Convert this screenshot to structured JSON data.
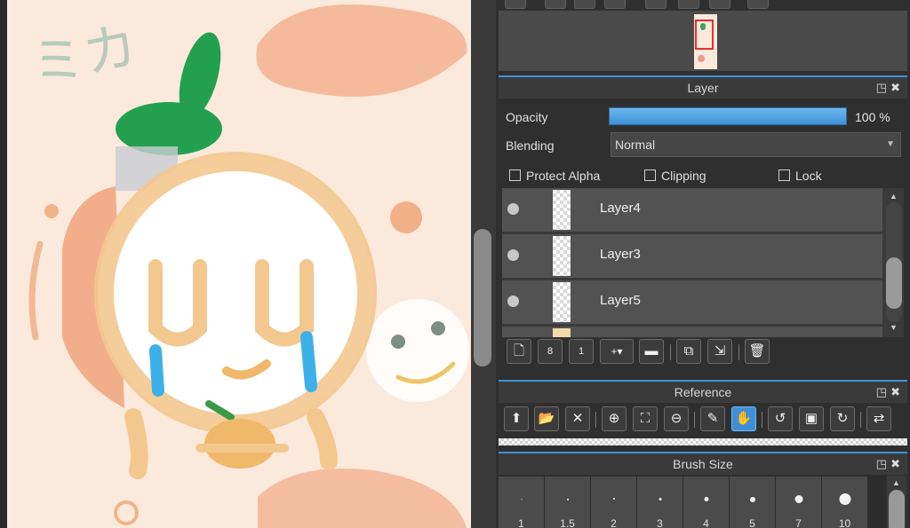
{
  "canvas": {
    "title_chars": "ミカ"
  },
  "layer_panel": {
    "title": "Layer",
    "opacity_label": "Opacity",
    "opacity_value": "100 %",
    "opacity_fraction": 1.0,
    "blending_label": "Blending",
    "blending_value": "Normal",
    "protect_alpha": "Protect Alpha",
    "clipping": "Clipping",
    "lock": "Lock",
    "layers": [
      {
        "name": "Layer4"
      },
      {
        "name": "Layer3"
      },
      {
        "name": "Layer5"
      }
    ],
    "buttons": [
      "new-layer",
      "new-8bit-layer",
      "new-1bit-layer",
      "add-layer-menu",
      "new-folder",
      "duplicate-layer",
      "merge-layer",
      "delete-layer"
    ]
  },
  "reference_panel": {
    "title": "Reference",
    "buttons": [
      "upload",
      "open-folder",
      "close",
      "zoom-in",
      "fit",
      "zoom-out",
      "eyedropper",
      "hand",
      "rotate-left",
      "fit-screen",
      "rotate-right",
      "flip"
    ]
  },
  "brush_size_panel": {
    "title": "Brush Size",
    "sizes": [
      "1",
      "1.5",
      "2",
      "3",
      "4",
      "5",
      "7",
      "10"
    ]
  },
  "colors": {
    "accent": "#3f93d6",
    "panel_bg": "#2f2f2f",
    "canvas_bg": "#fbe9dc"
  }
}
